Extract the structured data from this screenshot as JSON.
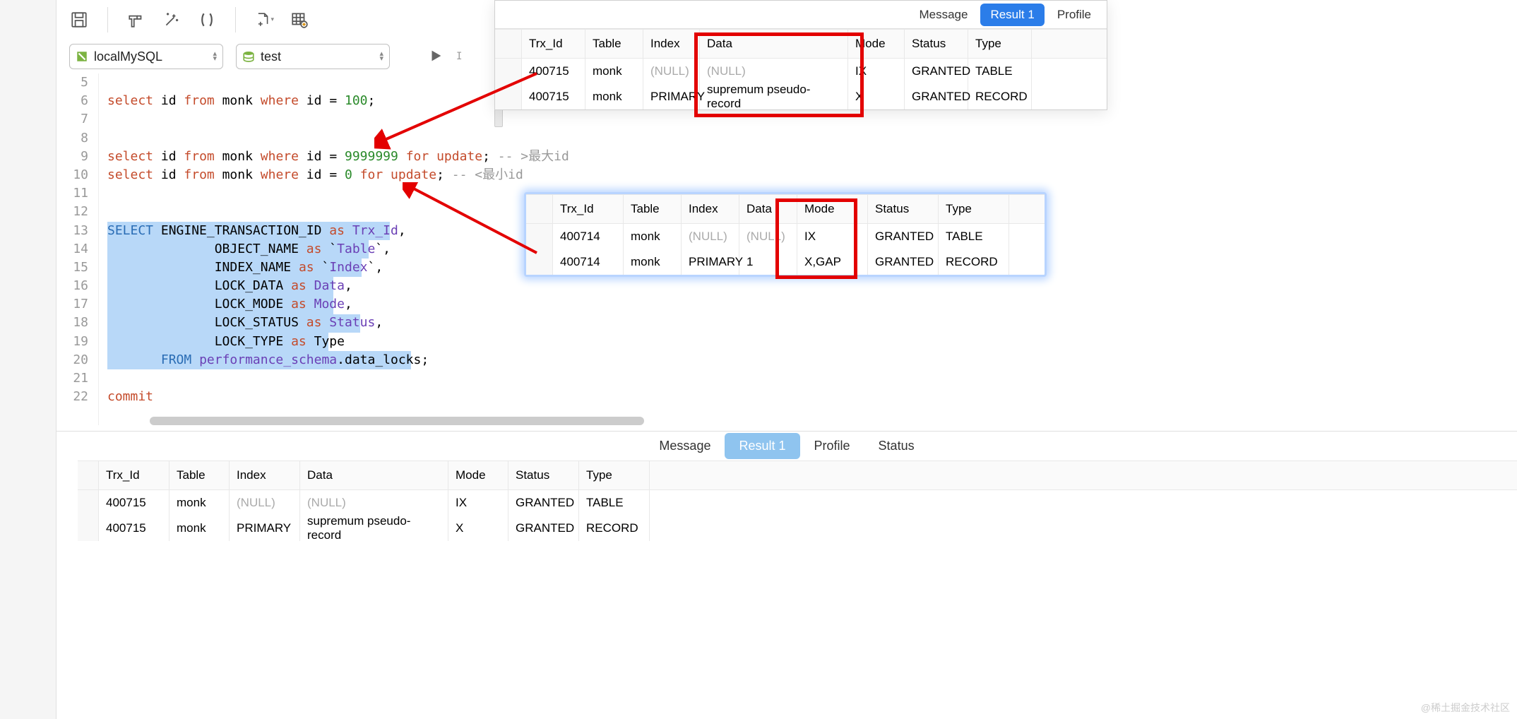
{
  "toolbar": {
    "conn_label": "localMySQL",
    "db_label": "test"
  },
  "editor": {
    "lines": [
      {
        "n": 5,
        "html": ""
      },
      {
        "n": 6,
        "html": "<span class='kw'>select</span> id <span class='kw'>from</span> monk <span class='kw'>where</span> id = <span class='num'>100</span>;"
      },
      {
        "n": 7,
        "html": ""
      },
      {
        "n": 8,
        "html": ""
      },
      {
        "n": 9,
        "html": "<span class='kw'>select</span> id <span class='kw'>from</span> monk <span class='kw'>where</span> id = <span class='num'>9999999</span> <span class='kw'>for</span> <span class='kw'>update</span>; <span class='comment'>-- >最大id</span>"
      },
      {
        "n": 10,
        "html": "<span class='kw'>select</span> id <span class='kw'>from</span> monk <span class='kw'>where</span> id = <span class='num'>0</span> <span class='kw'>for</span> <span class='kw'>update</span>; <span class='comment'>-- <最小id</span>"
      },
      {
        "n": 11,
        "html": ""
      },
      {
        "n": 12,
        "html": ""
      },
      {
        "n": 13,
        "html": "<span class='blue'>SELECT</span> ENGINE_TRANSACTION_ID <span class='kw'>as</span> <span class='ident'>Trx_Id</span>,"
      },
      {
        "n": 14,
        "html": "              OBJECT_NAME <span class='kw'>as</span> `<span class='ident'>Table</span>`,"
      },
      {
        "n": 15,
        "html": "              INDEX_NAME <span class='kw'>as</span> `<span class='ident'>Index</span>`,"
      },
      {
        "n": 16,
        "html": "              LOCK_DATA <span class='kw'>as</span> <span class='ident'>Data</span>,"
      },
      {
        "n": 17,
        "html": "              LOCK_MODE <span class='kw'>as</span> <span class='ident'>Mode</span>,"
      },
      {
        "n": 18,
        "html": "              LOCK_STATUS <span class='kw'>as</span> <span class='ident'>Status</span>,"
      },
      {
        "n": 19,
        "html": "              LOCK_TYPE <span class='kw'>as</span> Type"
      },
      {
        "n": 20,
        "html": "       <span class='blue'>FROM</span> <span class='ident'>performance_schema</span>.data_locks;"
      },
      {
        "n": 21,
        "html": ""
      },
      {
        "n": 22,
        "html": "<span class='kw'>commit</span>"
      }
    ]
  },
  "bottom_tabs": {
    "message": "Message",
    "result1": "Result 1",
    "profile": "Profile",
    "status": "Status"
  },
  "columns": {
    "trx": "Trx_Id",
    "table": "Table",
    "index": "Index",
    "data": "Data",
    "mode": "Mode",
    "status": "Status",
    "type": "Type"
  },
  "popup1": {
    "tabs": {
      "message": "Message",
      "result1": "Result 1",
      "profile": "Profile"
    },
    "rows": [
      {
        "trx": "400715",
        "table": "monk",
        "index": "(NULL)",
        "data": "(NULL)",
        "mode": "IX",
        "status": "GRANTED",
        "type": "TABLE"
      },
      {
        "trx": "400715",
        "table": "monk",
        "index": "PRIMARY",
        "data": "supremum pseudo-record",
        "mode": "X",
        "status": "GRANTED",
        "type": "RECORD"
      }
    ]
  },
  "popup2": {
    "rows": [
      {
        "trx": "400714",
        "table": "monk",
        "index": "(NULL)",
        "data": "(NULL)",
        "mode": "IX",
        "status": "GRANTED",
        "type": "TABLE"
      },
      {
        "trx": "400714",
        "table": "monk",
        "index": "PRIMARY",
        "data": "1",
        "mode": "X,GAP",
        "status": "GRANTED",
        "type": "RECORD"
      }
    ]
  },
  "bottom_result": {
    "rows": [
      {
        "trx": "400715",
        "table": "monk",
        "index": "(NULL)",
        "data": "(NULL)",
        "mode": "IX",
        "status": "GRANTED",
        "type": "TABLE"
      },
      {
        "trx": "400715",
        "table": "monk",
        "index": "PRIMARY",
        "data": "supremum pseudo-record",
        "mode": "X",
        "status": "GRANTED",
        "type": "RECORD"
      }
    ]
  },
  "watermark": "@稀土掘金技术社区"
}
